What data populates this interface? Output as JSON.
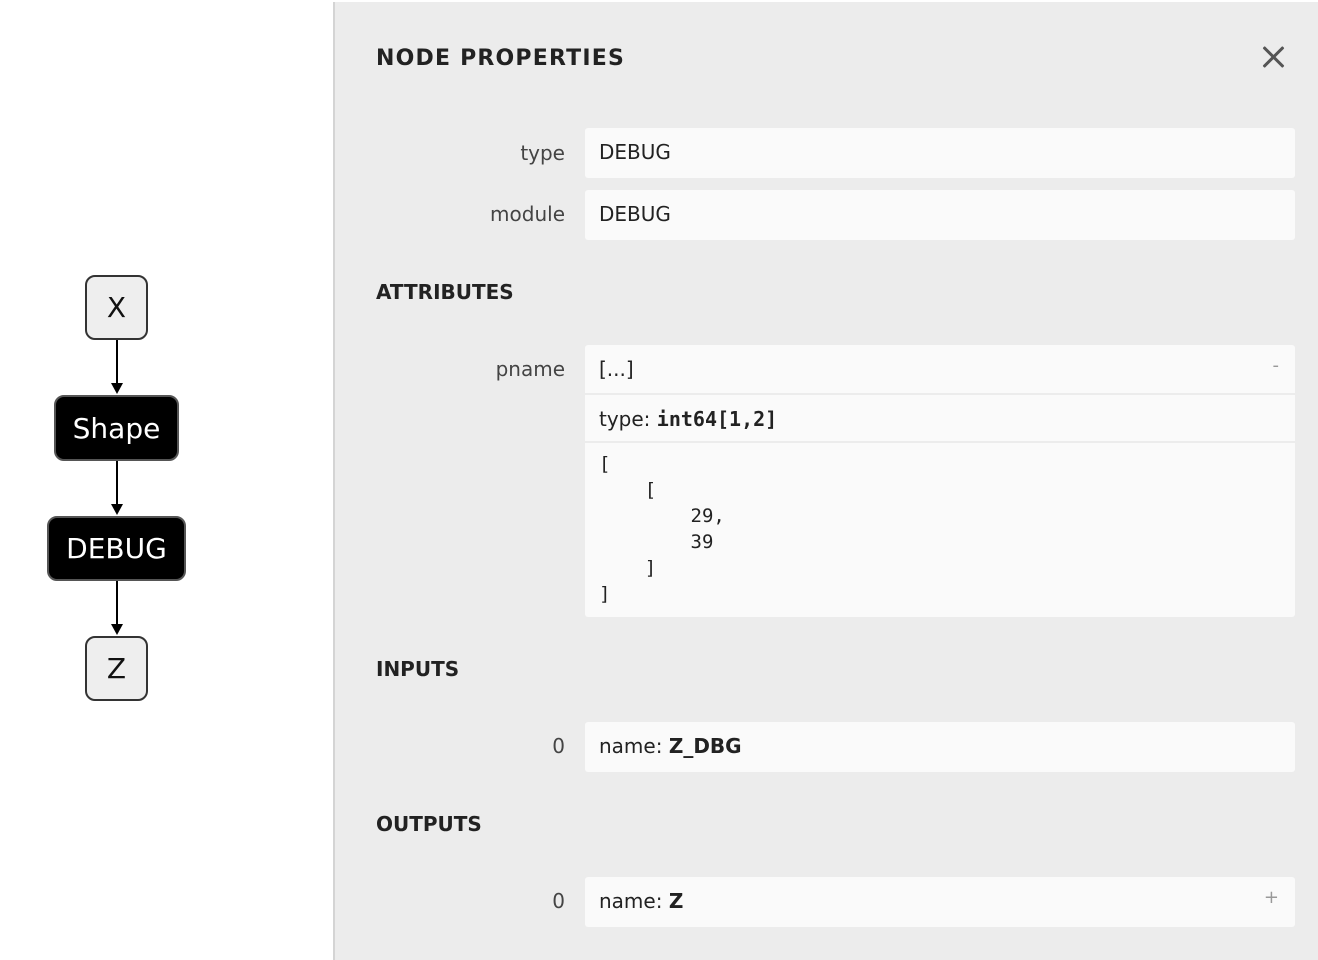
{
  "graph": {
    "nodes": [
      {
        "label": "X",
        "kind": "io"
      },
      {
        "label": "Shape",
        "kind": "op"
      },
      {
        "label": "DEBUG",
        "kind": "op"
      },
      {
        "label": "Z",
        "kind": "io"
      }
    ]
  },
  "panel": {
    "title": "NODE PROPERTIES",
    "close_icon": "close-icon",
    "properties": {
      "type_label": "type",
      "type_value": "DEBUG",
      "module_label": "module",
      "module_value": "DEBUG"
    },
    "attributes": {
      "heading": "ATTRIBUTES",
      "items": [
        {
          "label": "pname",
          "summary": "[...]",
          "toggle": "-",
          "type_prefix": "type:",
          "type_value": "int64[1,2]",
          "value_text": "[\n    [\n        29,\n        39\n    ]\n]"
        }
      ]
    },
    "inputs": {
      "heading": "INPUTS",
      "items": [
        {
          "index": "0",
          "name_prefix": "name:",
          "name_value": "Z_DBG"
        }
      ]
    },
    "outputs": {
      "heading": "OUTPUTS",
      "items": [
        {
          "index": "0",
          "name_prefix": "name:",
          "name_value": "Z",
          "toggle": "+"
        }
      ]
    }
  }
}
